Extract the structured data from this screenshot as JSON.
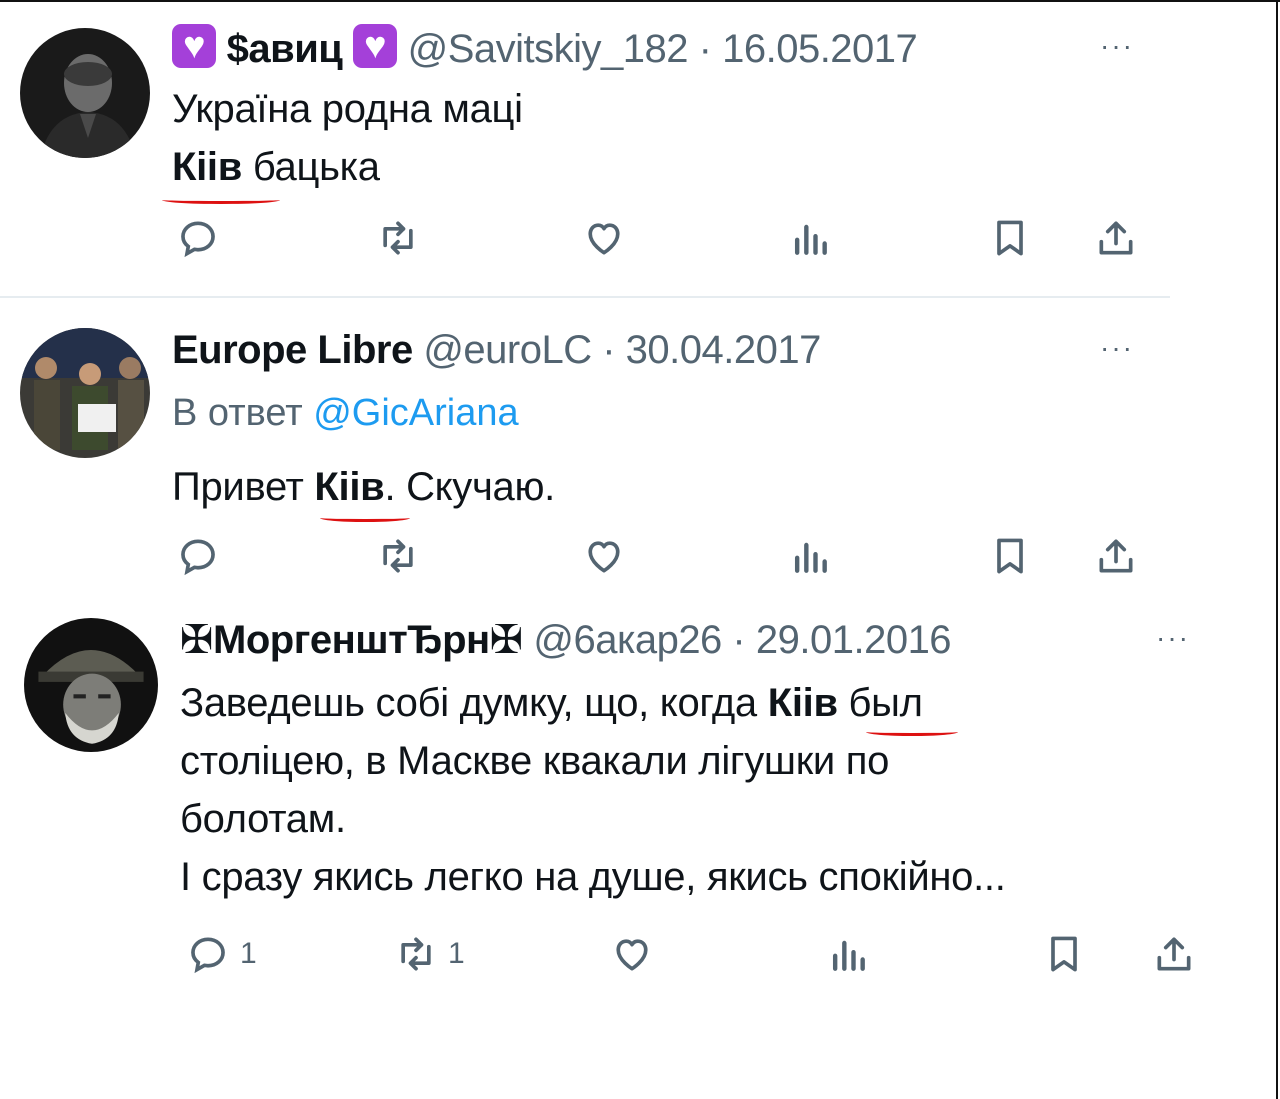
{
  "tweets": [
    {
      "display_name": "$авиц",
      "handle": "@Savitskiy_182",
      "date": "16.05.2017",
      "body_lines": [
        {
          "plain_before": "Україна родна маці",
          "bold": "",
          "plain_after": ""
        },
        {
          "plain_before": "",
          "bold": "Кіів",
          "plain_after": " бацька"
        }
      ],
      "reply_count": "",
      "retweet_count": "",
      "more_label": "···"
    },
    {
      "display_name": "Europe Libre",
      "handle": "@euroLC",
      "date": "30.04.2017",
      "replying_prefix": "В ответ",
      "replying_handle": "@GicAriana",
      "body_lines": [
        {
          "plain_before": "Привет ",
          "bold": "Кіів",
          "plain_after": ". Скучаю."
        }
      ],
      "reply_count": "",
      "retweet_count": "",
      "more_label": "···"
    },
    {
      "display_name": "✠МоргенштЂрн✠",
      "handle": "@6акар26",
      "date": "29.01.2016",
      "body_lines": [
        {
          "plain_before": "Заведешь собі думку, що, когда ",
          "bold": "Кіів",
          "plain_after": " был"
        },
        {
          "plain_before": "століцею, в Маскве квакали лігушки по",
          "bold": "",
          "plain_after": ""
        },
        {
          "plain_before": "болотам.",
          "bold": "",
          "plain_after": ""
        },
        {
          "plain_before": "І сразу якись легко на душе, якись спокійно...",
          "bold": "",
          "plain_after": ""
        }
      ],
      "reply_count": "1",
      "retweet_count": "1",
      "more_label": "···"
    }
  ],
  "separator": " · ",
  "colors": {
    "text": "#0f1419",
    "secondary": "#536471",
    "link": "#1d9bf0",
    "badge": "#a440d9",
    "annotation_underline": "#dd1111"
  },
  "icons": [
    "reply-icon",
    "retweet-icon",
    "like-icon",
    "views-icon",
    "bookmark-icon",
    "share-icon",
    "heart-badge-icon",
    "more-icon"
  ]
}
